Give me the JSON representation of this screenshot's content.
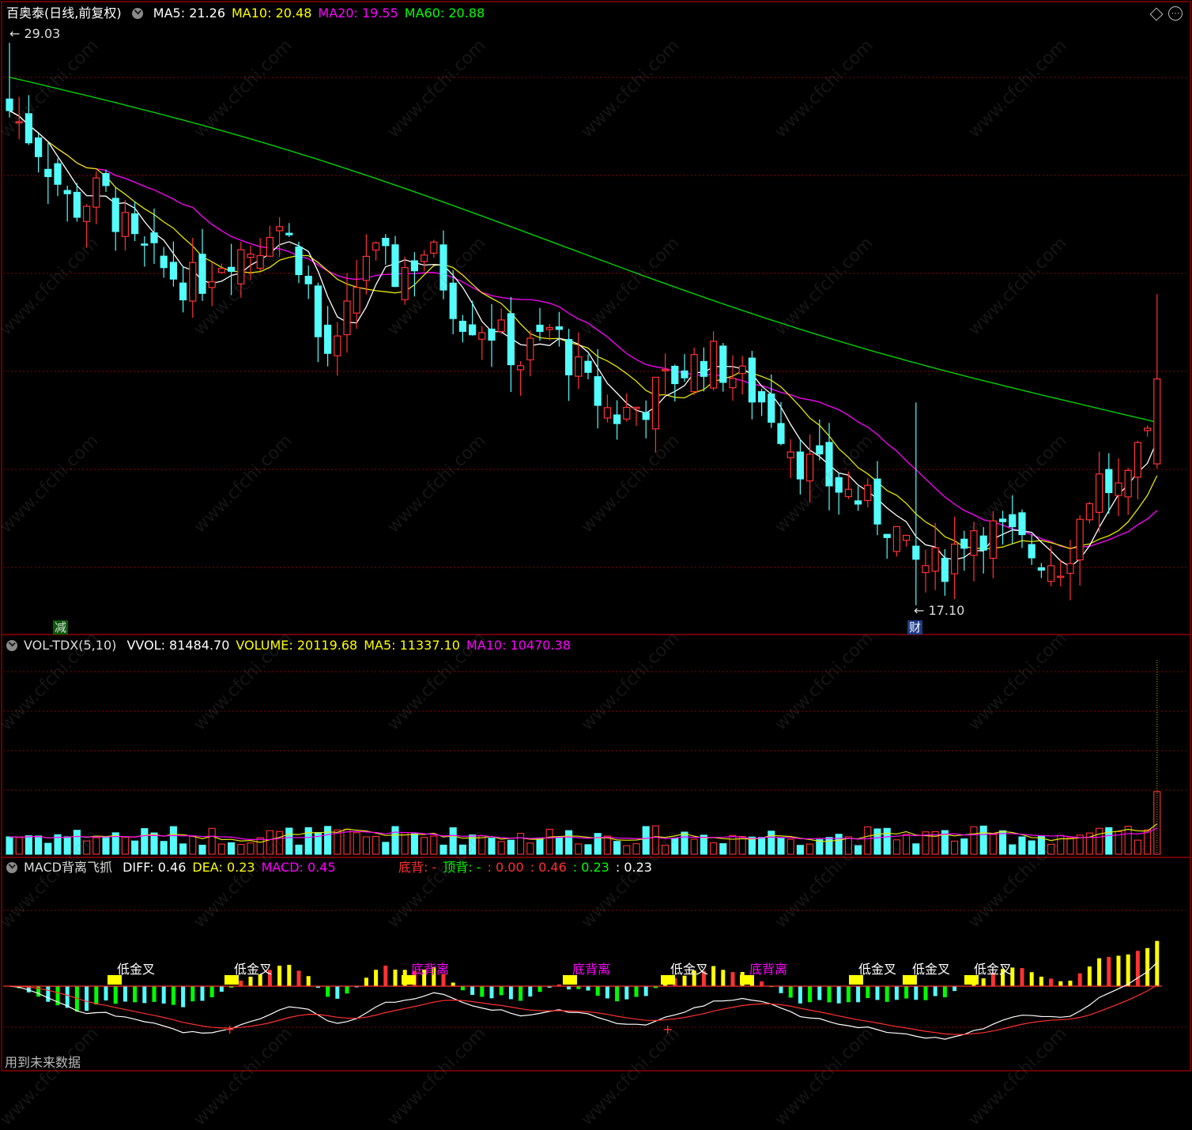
{
  "main_panel": {
    "stock_name": "百奥泰",
    "period_label": "(日线,前复权)",
    "indicators": [
      {
        "label": "MA5: 21.26",
        "color": "#ffffff"
      },
      {
        "label": "MA10: 20.48",
        "color": "#ffff00"
      },
      {
        "label": "MA20: 19.55",
        "color": "#ff00ff"
      },
      {
        "label": "MA60: 20.88",
        "color": "#00ff00"
      }
    ],
    "high_label": "29.03",
    "low_label": "17.10",
    "marker_jian": "减",
    "marker_cai": "财"
  },
  "volume_panel": {
    "name": "VOL-TDX(5,10)",
    "indicators": [
      {
        "label": "VVOL: 81484.70",
        "color": "#ffffff"
      },
      {
        "label": "VOLUME: 20119.68",
        "color": "#ffff00"
      },
      {
        "label": "MA5: 11337.10",
        "color": "#ffff00"
      },
      {
        "label": "MA10: 10470.38",
        "color": "#ff00ff"
      }
    ]
  },
  "macd_panel": {
    "name": "MACD背离飞抓",
    "indicators": [
      {
        "label": "DIFF: 0.46",
        "color": "#ffffff"
      },
      {
        "label": "DEA: 0.23",
        "color": "#ffff00"
      },
      {
        "label": "MACD: 0.45",
        "color": "#ff00ff"
      }
    ],
    "extra": [
      {
        "label": "底背: -",
        "color": "#ff3030"
      },
      {
        "label": "顶背: -",
        "color": "#00ff00"
      },
      {
        "label": ": 0.00",
        "color": "#ff3030"
      },
      {
        "label": ": 0.46",
        "color": "#ff3030"
      },
      {
        "label": ": 0.23",
        "color": "#00ff00"
      },
      {
        "label": ": 0.23",
        "color": "#ffffff"
      }
    ],
    "signals": [
      {
        "text": "低金叉",
        "color": "#ffffff"
      },
      {
        "text": "低金叉",
        "color": "#ffffff"
      },
      {
        "text": "底背离",
        "color": "#ff00ff"
      },
      {
        "text": "底背离",
        "color": "#ff00ff"
      },
      {
        "text": "低金叉",
        "color": "#ffffff"
      },
      {
        "text": "底背离",
        "color": "#ff00ff"
      },
      {
        "text": "低金叉",
        "color": "#ffffff"
      },
      {
        "text": "低金叉",
        "color": "#ffffff"
      },
      {
        "text": "低金叉",
        "color": "#ffffff"
      }
    ],
    "footer": "用到未来数据"
  },
  "colors": {
    "up": "#ff3232",
    "down": "#54fcfc",
    "grid": "#8b0000",
    "border": "#b00000"
  },
  "watermark": "www.cfchi.com",
  "chart_data": {
    "type": "candlestick",
    "price_range": [
      17.1,
      29.03
    ],
    "ohlc": [],
    "ma": {}
  }
}
